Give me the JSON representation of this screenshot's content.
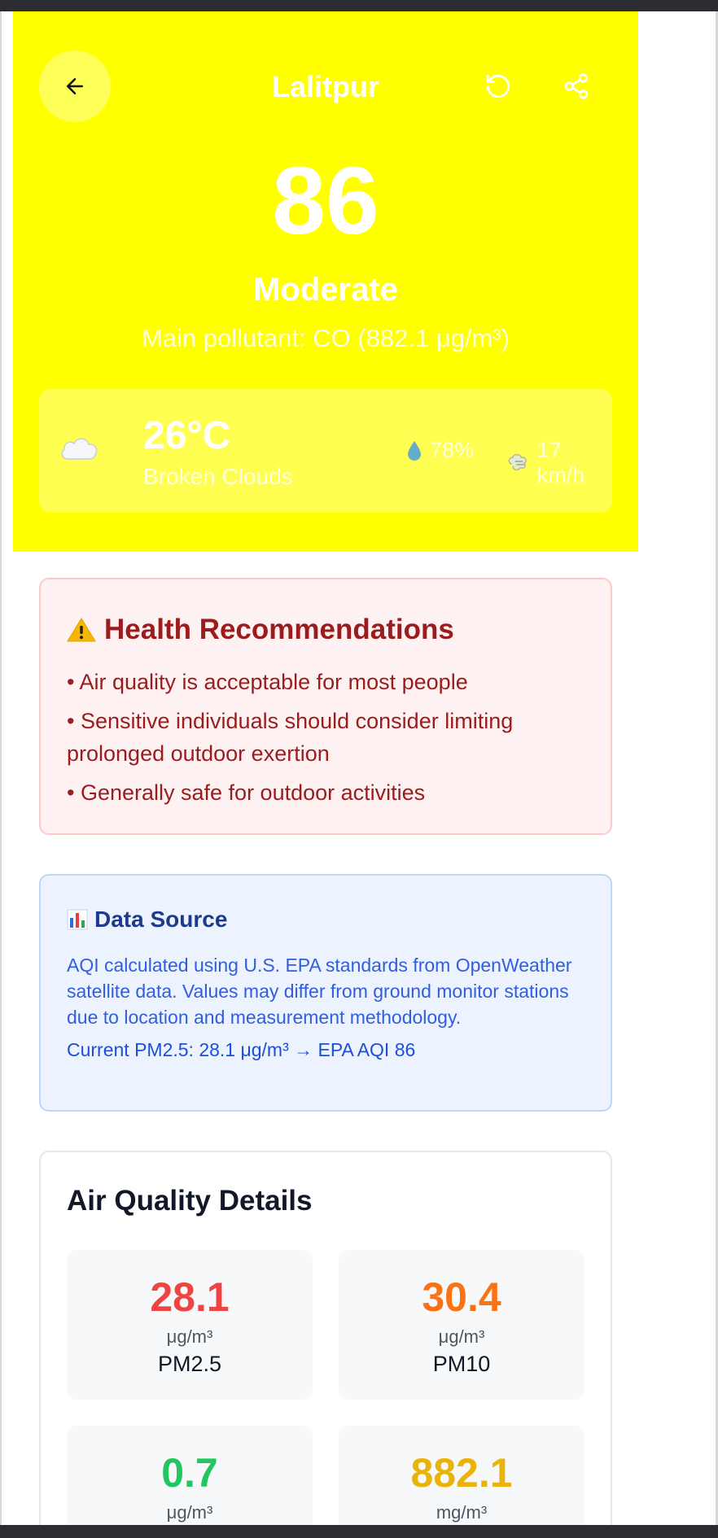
{
  "colors": {
    "hero_bg": "#ffff00",
    "good": "#22c55e",
    "moderate": "#eab308",
    "unhealthy_sensitive": "#f97316",
    "unhealthy": "#ef4444"
  },
  "header": {
    "city": "Lalitpur",
    "back_icon": "arrow-left-icon",
    "refresh_icon": "refresh-icon",
    "share_icon": "share-icon"
  },
  "aqi": {
    "value": "86",
    "category": "Moderate",
    "main_pollutant": "Main pollutant: CO (882.1 μg/m³)"
  },
  "weather": {
    "temperature": "26°C",
    "condition": "Broken Clouds",
    "humidity": "78%",
    "wind": "17 km/h",
    "condition_icon": "cloud-icon"
  },
  "health": {
    "title": "Health Recommendations",
    "items": [
      "• Air quality is acceptable for most people",
      "• Sensitive individuals should consider limiting prolonged outdoor exertion",
      "• Generally safe for outdoor activities"
    ]
  },
  "data_source": {
    "title": "Data Source",
    "description": "AQI calculated using U.S. EPA standards from OpenWeather satellite data. Values may differ from ground monitor stations due to location and measurement methodology.",
    "current": "Current PM2.5: 28.1 μg/m³ → EPA AQI 86"
  },
  "details": {
    "title": "Air Quality Details",
    "metrics": [
      {
        "value": "28.1",
        "unit": "μg/m³",
        "name": "PM2.5",
        "color": "#ef4444"
      },
      {
        "value": "30.4",
        "unit": "μg/m³",
        "name": "PM10",
        "color": "#f97316"
      },
      {
        "value": "0.7",
        "unit": "μg/m³",
        "name": "",
        "color": "#22c55e"
      },
      {
        "value": "882.1",
        "unit": "mg/m³",
        "name": "",
        "color": "#eab308"
      }
    ]
  }
}
